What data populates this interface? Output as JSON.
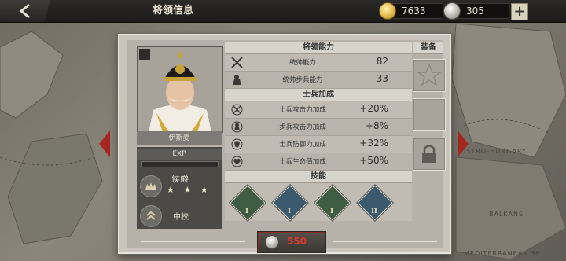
{
  "header": {
    "title": "将领信息",
    "back_icon": "chevron-left-icon",
    "gold": "7633",
    "silver": "305",
    "add_icon": "plus-icon"
  },
  "map": {
    "labels": [
      "ISTRO-HUNGARY",
      "BALKANS",
      "MEDITERRANEAN SE"
    ]
  },
  "general": {
    "name": "伊斯麦",
    "exp_label": "EXP",
    "exp_progress": 0.0,
    "noble_title": "侯爵",
    "stars": "★ ★ ★",
    "rank": "中校"
  },
  "abilities": {
    "heading": "将领能力",
    "rows": [
      {
        "label": "统帅能力",
        "value": "82",
        "icon": "crossed-swords-icon"
      },
      {
        "label": "统帅步兵能力",
        "value": "33",
        "icon": "infantry-icon"
      }
    ]
  },
  "bonuses": {
    "heading": "士兵加成",
    "rows": [
      {
        "label": "士兵攻击力加成",
        "value": "+20%",
        "icon": "attack-icon"
      },
      {
        "label": "步兵攻击力加成",
        "value": "+8%",
        "icon": "infantry-attack-icon"
      },
      {
        "label": "士兵防御力加成",
        "value": "+32%",
        "icon": "shield-icon"
      },
      {
        "label": "士兵生命值加成",
        "value": "+50%",
        "icon": "heart-icon"
      }
    ]
  },
  "skills": {
    "heading": "技能",
    "items": [
      {
        "level": "I",
        "icon": "charge-skill-icon",
        "color": "#3f5d42"
      },
      {
        "level": "I",
        "icon": "cavalry-skill-icon",
        "color": "#3c5a6e"
      },
      {
        "level": "I",
        "icon": "sprint-skill-icon",
        "color": "#3f5d42"
      },
      {
        "level": "II",
        "icon": "artillery-skill-icon",
        "color": "#3c5a6e"
      }
    ]
  },
  "equipment": {
    "heading": "装备",
    "slots": [
      "medal-slot-icon",
      "empty-slot",
      "lock-icon"
    ]
  },
  "upgrade": {
    "cost": "550",
    "currency_icon": "silver-coin-icon"
  },
  "colors": {
    "cost_red": "#d33a2e",
    "gold_coin": "#e2b94a"
  }
}
